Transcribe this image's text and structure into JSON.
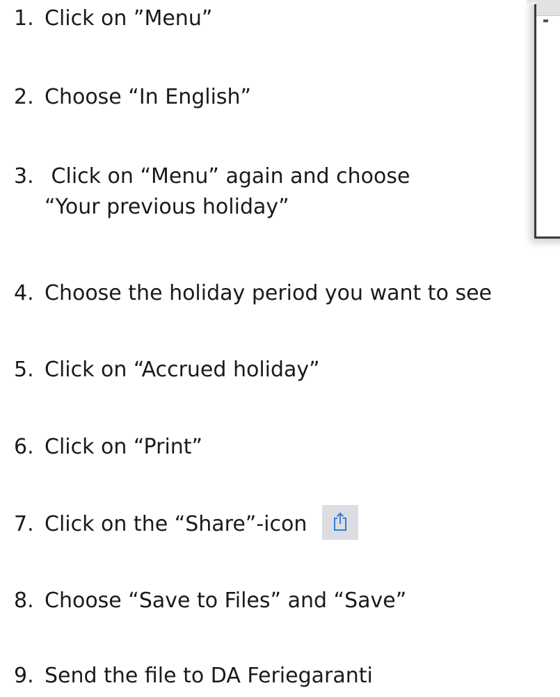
{
  "steps": [
    {
      "number": "1.",
      "text": "Click on ”Menu”"
    },
    {
      "number": "2.",
      "text": "Choose “In English”"
    },
    {
      "number": "3.",
      "text": " Click on “Menu” again and choose",
      "text2": "“Your previous holiday”"
    },
    {
      "number": "4.",
      "text": "Choose the holiday period you want to see"
    },
    {
      "number": "5.",
      "text": "Click on “Accrued holiday”"
    },
    {
      "number": "6.",
      "text": "Click on “Print”"
    },
    {
      "number": "7.",
      "text": "Click on the “Share”-icon",
      "icon": "share-icon"
    },
    {
      "number": "8.",
      "text": "Choose “Save to Files” and “Save”"
    },
    {
      "number": "9.",
      "text": "Send the file to DA Feriegaranti"
    }
  ],
  "colors": {
    "text": "#1a1a1a",
    "share_icon": "#2f7fd8",
    "share_icon_background": "#dcdde2"
  }
}
